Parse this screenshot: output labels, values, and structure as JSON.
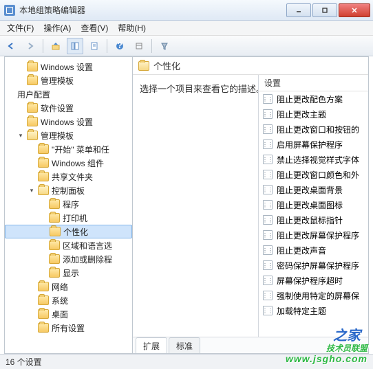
{
  "window": {
    "title": "本地组策略编辑器"
  },
  "menubar": [
    "文件(F)",
    "操作(A)",
    "查看(V)",
    "帮助(H)"
  ],
  "tree": [
    {
      "level": 1,
      "exp": "",
      "label": "Windows 设置",
      "open": false
    },
    {
      "level": 1,
      "exp": "",
      "label": "管理模板",
      "open": false
    },
    {
      "level": 0,
      "exp": "",
      "label": "用户配置",
      "open": true,
      "plain": true
    },
    {
      "level": 1,
      "exp": "",
      "label": "软件设置",
      "open": false
    },
    {
      "level": 1,
      "exp": "",
      "label": "Windows 设置",
      "open": false
    },
    {
      "level": 1,
      "exp": "▾",
      "label": "管理模板",
      "open": true
    },
    {
      "level": 2,
      "exp": "",
      "label": "\"开始\" 菜单和任",
      "open": false
    },
    {
      "level": 2,
      "exp": "",
      "label": "Windows 组件",
      "open": false
    },
    {
      "level": 2,
      "exp": "",
      "label": "共享文件夹",
      "open": false
    },
    {
      "level": 2,
      "exp": "▾",
      "label": "控制面板",
      "open": true
    },
    {
      "level": 3,
      "exp": "",
      "label": "程序",
      "open": false
    },
    {
      "level": 3,
      "exp": "",
      "label": "打印机",
      "open": false
    },
    {
      "level": 3,
      "exp": "",
      "label": "个性化",
      "open": false,
      "selected": true
    },
    {
      "level": 3,
      "exp": "",
      "label": "区域和语言选",
      "open": false
    },
    {
      "level": 3,
      "exp": "",
      "label": "添加或删除程",
      "open": false
    },
    {
      "level": 3,
      "exp": "",
      "label": "显示",
      "open": false
    },
    {
      "level": 2,
      "exp": "",
      "label": "网络",
      "open": false
    },
    {
      "level": 2,
      "exp": "",
      "label": "系统",
      "open": false
    },
    {
      "level": 2,
      "exp": "",
      "label": "桌面",
      "open": false
    },
    {
      "level": 2,
      "exp": "",
      "label": "所有设置",
      "open": false
    }
  ],
  "content": {
    "title": "个性化",
    "description": "选择一个项目来查看它的描述。"
  },
  "settings": {
    "header": "设置",
    "items": [
      "阻止更改配色方案",
      "阻止更改主题",
      "阻止更改窗口和按钮的",
      "启用屏幕保护程序",
      "禁止选择视觉样式字体",
      "阻止更改窗口颜色和外",
      "阻止更改桌面背景",
      "阻止更改桌面图标",
      "阻止更改鼠标指针",
      "阻止更改屏幕保护程序",
      "阻止更改声音",
      "密码保护屏幕保护程序",
      "屏幕保护程序超时",
      "强制使用特定的屏幕保",
      "加载特定主题"
    ]
  },
  "tabs": {
    "extended": "扩展",
    "standard": "标准"
  },
  "status": "16 个设置",
  "watermark": {
    "main": "技术员联盟",
    "url": "www.jsgho.com",
    "zhijia": "之家"
  }
}
